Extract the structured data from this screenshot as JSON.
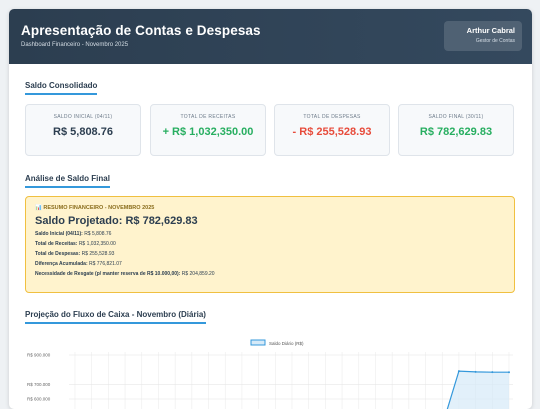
{
  "header": {
    "title": "Apresentação de Contas e Despesas",
    "subtitle": "Dashboard Financeiro - Novembro 2025",
    "user_name": "Arthur Cabral",
    "user_role": "Gestor de Contas"
  },
  "saldo": {
    "section_title": "Saldo Consolidado",
    "cards": [
      {
        "label": "SALDO INICIAL (04/11)",
        "value": "R$ 5,808.76"
      },
      {
        "label": "TOTAL DE RECEITAS",
        "value": "+ R$ 1,032,350.00"
      },
      {
        "label": "TOTAL DE DESPESAS",
        "value": "- R$ 255,528.93"
      },
      {
        "label": "SALDO FINAL (30/11)",
        "value": "R$ 782,629.83"
      }
    ]
  },
  "analise": {
    "section_title": "Análise de Saldo Final",
    "heading": "📊 RESUMO FINANCEIRO - NOVEMBRO 2025",
    "projected": "Saldo Projetado: R$ 782,629.83",
    "rows": [
      {
        "label": "Saldo Inicial (04/11):",
        "value": "R$ 5,808.76"
      },
      {
        "label": "Total de Receitas:",
        "value": "R$ 1,032,350.00"
      },
      {
        "label": "Total de Despesas:",
        "value": "R$ 255,528.93"
      },
      {
        "label": "Diferença Acumulada:",
        "value": "R$ 776,821.07"
      },
      {
        "label": "Necessidade de Resgate (p/ manter reserva de R$ 10.000,00):",
        "value": "R$ 204,859.20"
      }
    ]
  },
  "colors": {
    "positive": "#27ae60",
    "negative": "#e74c3c",
    "neutral": "#2c3e50",
    "accent": "#3498db"
  },
  "projecao": {
    "section_title": "Projeção do Fluxo de Caixa - Novembro (Diária)"
  },
  "chart_data": {
    "type": "area",
    "title": "",
    "xlabel": "",
    "ylabel": "",
    "legend": "top-center",
    "grid": true,
    "ylim": [
      550000,
      900000
    ],
    "yticks": [
      "R$ 900.000",
      "R$ 700.000",
      "R$ 600.000"
    ],
    "series": [
      {
        "name": "Saldo Diário (R$)",
        "x": [
          0,
          1,
          2,
          3,
          4,
          5,
          6,
          7,
          8,
          9,
          10,
          11,
          12,
          13,
          14,
          15,
          16,
          17,
          18,
          19,
          20,
          21,
          22,
          23,
          24,
          25,
          26
        ],
        "values": [
          5808.76,
          5808.76,
          5808.76,
          5808.76,
          5808.76,
          5808.76,
          5808.76,
          5808.76,
          5808.76,
          5808.76,
          5808.76,
          5808.76,
          5808.76,
          5808.76,
          5808.76,
          5808.76,
          5808.76,
          5808.76,
          5808.76,
          5808.76,
          5808.76,
          5808.76,
          5808.76,
          790000,
          785000,
          783000,
          782629.83
        ]
      }
    ]
  }
}
